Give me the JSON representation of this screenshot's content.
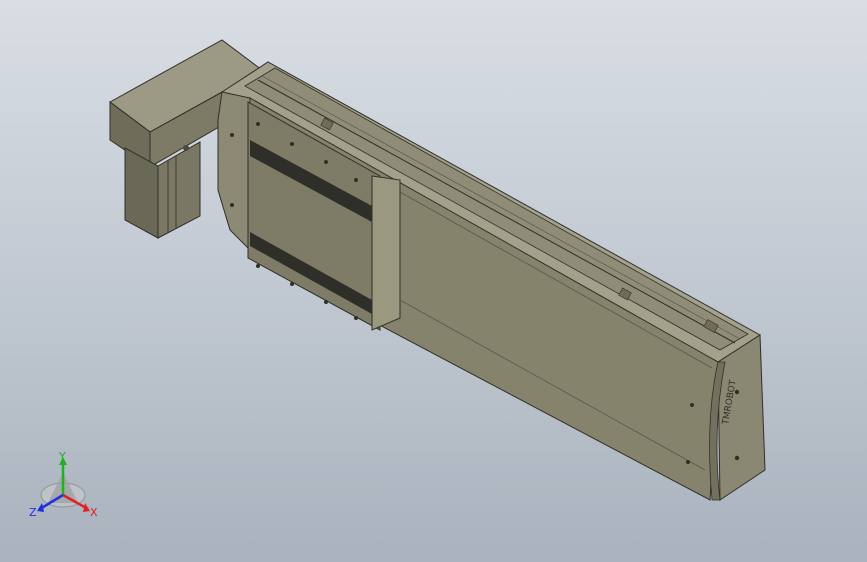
{
  "viewport": {
    "background_top": "#d9dee4",
    "background_bottom": "#a9b2bd"
  },
  "model": {
    "body_color": "#85836c",
    "edge_color": "#2f2f28",
    "end_plate_logo": "TMROBOT"
  },
  "triad": {
    "x_label": "X",
    "y_label": "Y",
    "z_label": "Z",
    "x_color": "#e02020",
    "y_color": "#20b020",
    "z_color": "#2030e0"
  }
}
